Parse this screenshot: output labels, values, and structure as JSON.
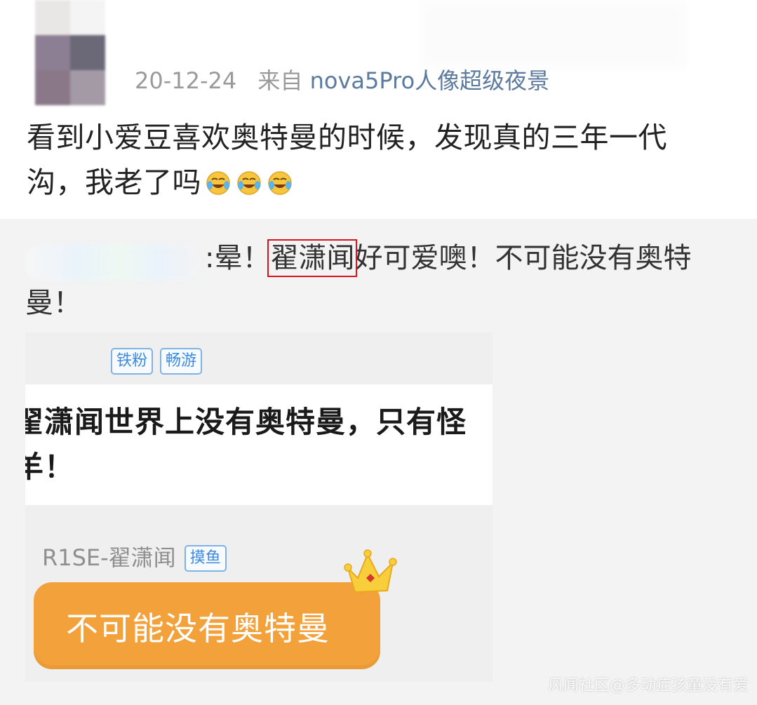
{
  "post": {
    "date": "20-12-24",
    "source_prefix": "来自",
    "device": "nova5Pro人像超级夜景",
    "text_line1": "看到小爱豆喜欢奥特曼的时候，发现真的三年一代",
    "text_line2": "沟，我老了吗",
    "emoji_name": "laughing-crying-emoji"
  },
  "repost": {
    "text_before": ":晕！",
    "highlight": "翟潇闻",
    "text_after_line1": "好可爱噢！不可能没有奥特",
    "text_line2": "曼！",
    "highlight_color": "#d8121f",
    "card": {
      "badge_1": "铁粉",
      "badge_2": "畅游",
      "quote_line1": "翟潇闻世界上没有奥特曼，只有怪",
      "quote_line2": "羊！",
      "author": "R1SE-翟潇闻",
      "author_badge": "摸鱼",
      "bubble_text": "不可能没有奥特曼",
      "bubble_color": "#f3a23b"
    }
  },
  "watermark": "风闻社区@多动症孩童没有爱"
}
